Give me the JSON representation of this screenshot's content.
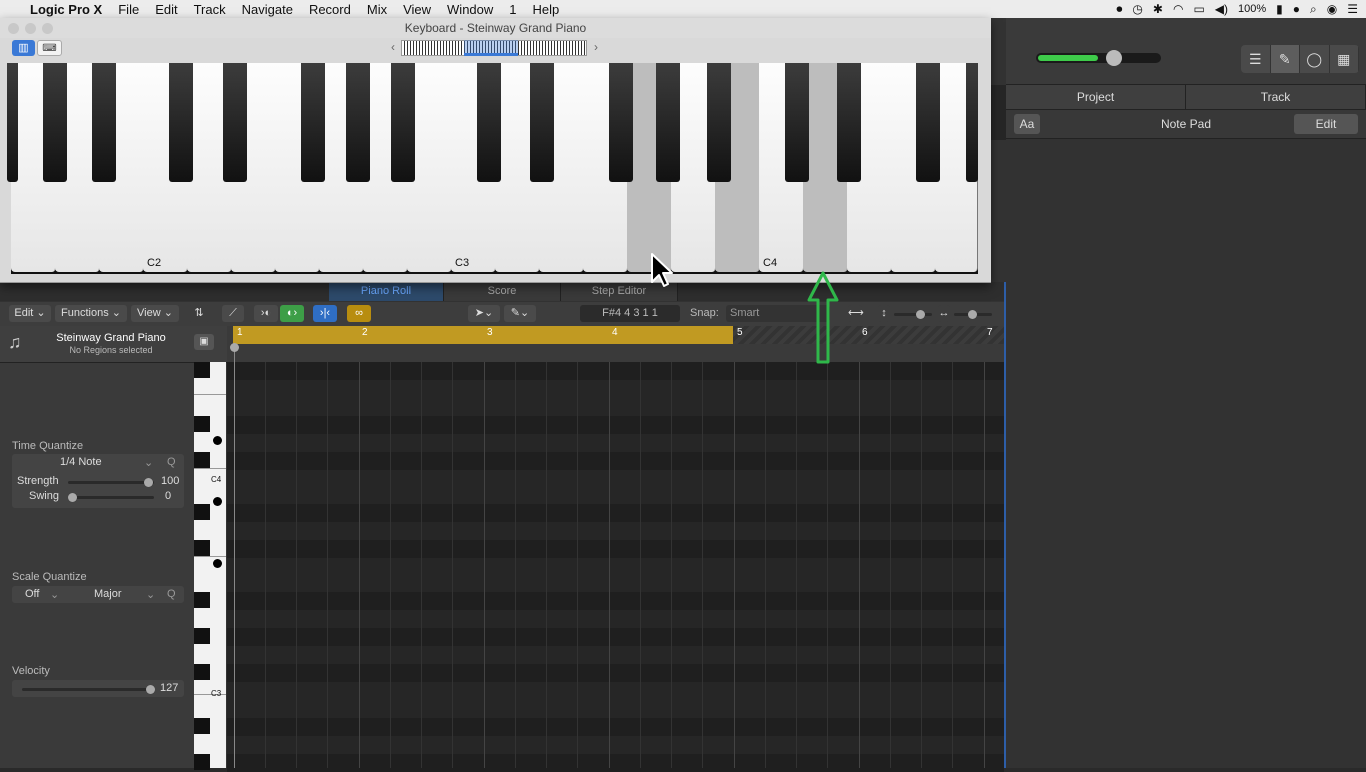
{
  "menubar": {
    "app": "Logic Pro X",
    "items": [
      "File",
      "Edit",
      "Track",
      "Navigate",
      "Record",
      "Mix",
      "View",
      "Window",
      "1",
      "Help"
    ],
    "battery": "100%"
  },
  "keyboard_window": {
    "title": "Keyboard - Steinway Grand Piano",
    "octave_labels": [
      "C2",
      "C3",
      "C4"
    ]
  },
  "piano_roll": {
    "tabs": [
      "Piano Roll",
      "Score",
      "Step Editor"
    ],
    "active_tab": "Piano Roll",
    "toolbar": {
      "edit": "Edit",
      "functions": "Functions",
      "view": "View",
      "position": "F#4  4 3 1 1",
      "snap_label": "Snap:",
      "snap_value": "Smart"
    },
    "bar_numbers": [
      "1",
      "2",
      "3",
      "4",
      "5",
      "6",
      "7"
    ]
  },
  "inspector": {
    "track_name": "Steinway Grand Piano",
    "region_status": "No Regions selected",
    "time_quantize": {
      "label": "Time Quantize",
      "value": "1/4 Note",
      "q": "Q",
      "strength_label": "Strength",
      "strength_value": "100",
      "swing_label": "Swing",
      "swing_value": "0"
    },
    "scale_quantize": {
      "label": "Scale Quantize",
      "value1": "Off",
      "value2": "Major",
      "q": "Q"
    },
    "velocity": {
      "label": "Velocity",
      "value": "127"
    },
    "key_labels": [
      "C4",
      "C3"
    ]
  },
  "right_panel": {
    "tabs": [
      "Project",
      "Track"
    ],
    "aa": "Aa",
    "title": "Note Pad",
    "edit": "Edit"
  },
  "colors": {
    "accent": "#3a79d6",
    "region": "#c19a22",
    "annotation": "#2fb84a"
  }
}
